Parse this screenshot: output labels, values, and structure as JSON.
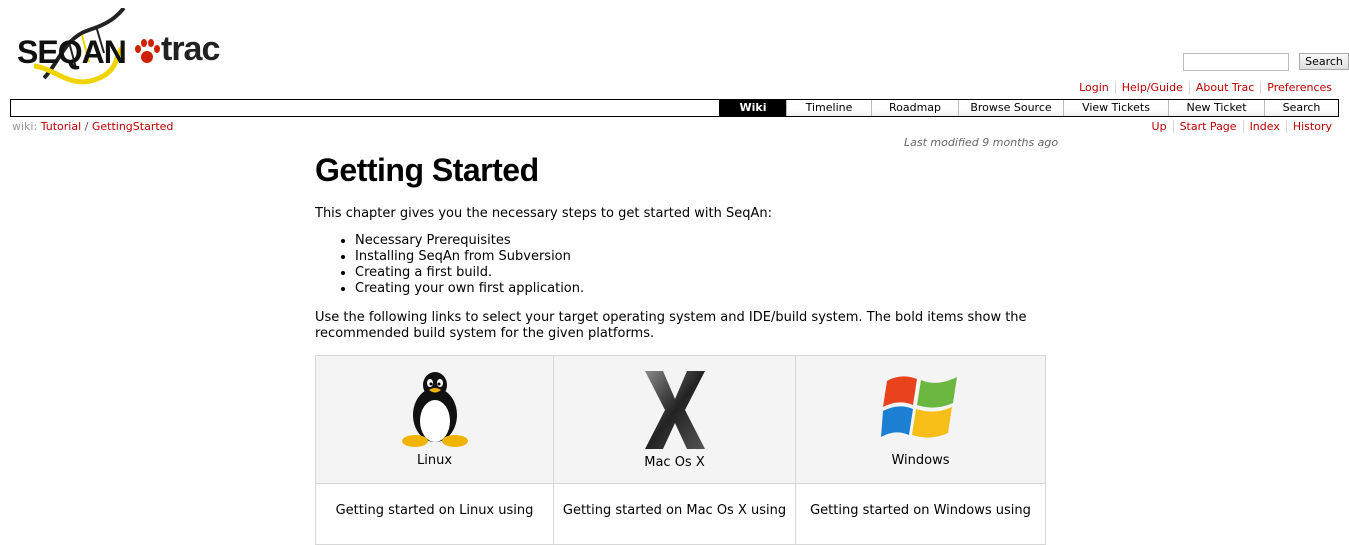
{
  "brand": {
    "logo_seqan": "SEQAN",
    "logo_trac": "trac"
  },
  "search": {
    "input_value": "",
    "button_label": "Search"
  },
  "metanav": [
    "Login",
    "Help/Guide",
    "About Trac",
    "Preferences"
  ],
  "mainnav": [
    {
      "label": "Wiki",
      "active": true
    },
    {
      "label": "Timeline",
      "active": false
    },
    {
      "label": "Roadmap",
      "active": false
    },
    {
      "label": "Browse Source",
      "active": false
    },
    {
      "label": "View Tickets",
      "active": false
    },
    {
      "label": "New Ticket",
      "active": false
    },
    {
      "label": "Search",
      "active": false
    }
  ],
  "breadcrumb": {
    "prefix": "wiki:",
    "parts": [
      "Tutorial",
      "/",
      "GettingStarted"
    ]
  },
  "ctxtnav": [
    "Up",
    "Start Page",
    "Index",
    "History"
  ],
  "lastmod": {
    "prefix": "Last modified",
    "age": "9 months ago"
  },
  "page": {
    "title": "Getting Started",
    "intro": "This chapter gives you the necessary steps to get started with SeqAn:",
    "steps": [
      "Necessary Prerequisites",
      "Installing SeqAn from Subversion",
      "Creating a first build.",
      "Creating your own first application."
    ],
    "links_text": "Use the following links to select your target operating system and IDE/build system. The bold items show the recommended build system for the given platforms."
  },
  "platforms": [
    {
      "name": "Linux",
      "icon": "linux-penguin-icon",
      "caption": "Getting started on Linux using"
    },
    {
      "name": "Mac Os X",
      "icon": "mac-os-x-icon",
      "caption": "Getting started on Mac Os X using"
    },
    {
      "name": "Windows",
      "icon": "windows-logo-icon",
      "caption": "Getting started on Windows using"
    }
  ],
  "colors": {
    "link": "#bb0000",
    "nav_active_bg": "#000000",
    "logo_yellow": "#f0d400",
    "paw_red": "#cc2200"
  }
}
